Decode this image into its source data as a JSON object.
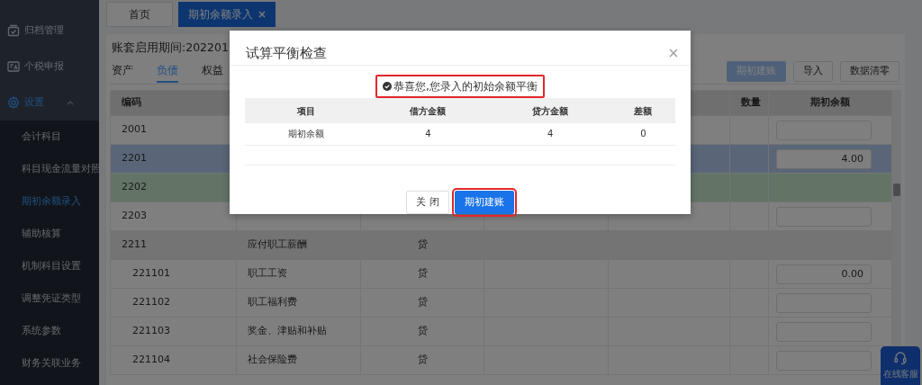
{
  "sidebar": {
    "items": [
      {
        "label": "归档管理",
        "kind": "archive",
        "expanded": false
      },
      {
        "label": "个税申报",
        "kind": "tax",
        "expanded": false
      },
      {
        "label": "设置",
        "kind": "settings",
        "expanded": true,
        "children": [
          {
            "label": "会计科目",
            "selected": false
          },
          {
            "label": "科目现金流量对照",
            "selected": false
          },
          {
            "label": "期初余额录入",
            "selected": true
          },
          {
            "label": "辅助核算",
            "selected": false
          },
          {
            "label": "机制科目设置",
            "selected": false
          },
          {
            "label": "调整凭证类型",
            "selected": false
          },
          {
            "label": "系统参数",
            "selected": false
          },
          {
            "label": "财务关联业务",
            "selected": false
          }
        ]
      }
    ]
  },
  "tabs": [
    {
      "label": "首页",
      "selected": false,
      "closable": false
    },
    {
      "label": "期初余额录入",
      "selected": true,
      "closable": true
    }
  ],
  "period_label": "账套启用期间:202201",
  "category_tabs": [
    {
      "label": "资产",
      "selected": false
    },
    {
      "label": "负债",
      "selected": true
    },
    {
      "label": "权益",
      "selected": false
    }
  ],
  "toolbar_buttons": [
    {
      "label": "期初建账",
      "kind": "primary"
    },
    {
      "label": "导入",
      "kind": "default"
    },
    {
      "label": "数据清零",
      "kind": "default"
    }
  ],
  "table": {
    "columns": {
      "code": "编码",
      "quantity": "数量",
      "opening_balance": "期初余额"
    },
    "rows": [
      {
        "code": "2001",
        "selected": false,
        "hovered": false,
        "editable": true
      },
      {
        "code": "2201",
        "selected": true,
        "hovered": false,
        "editable": true,
        "balance": "4.00"
      },
      {
        "code": "2202",
        "selected": false,
        "hovered": true,
        "editable": false
      },
      {
        "code": "2203",
        "selected": false,
        "hovered": false,
        "editable": true
      },
      {
        "code": "2211",
        "name": "应付职工薪酬",
        "direction": "贷",
        "selected": false,
        "hovered": false,
        "editable": false,
        "children": [
          {
            "code": "221101",
            "name": "职工工资",
            "direction": "贷",
            "selected": false,
            "hovered": false,
            "editable": true,
            "balance": "0.00"
          },
          {
            "code": "221102",
            "name": "职工福利费",
            "direction": "贷",
            "selected": false,
            "hovered": false,
            "editable": true
          },
          {
            "code": "221103",
            "name": "奖金、津贴和补贴",
            "direction": "贷",
            "selected": false,
            "hovered": false,
            "editable": true
          },
          {
            "code": "221104",
            "name": "社会保险费",
            "direction": "贷",
            "selected": false,
            "hovered": false,
            "editable": true
          }
        ]
      }
    ]
  },
  "modal": {
    "title": "试算平衡检查",
    "message": "恭喜您,您录入的初始余额平衡",
    "message_highlighted": true,
    "columns": [
      "项目",
      "借方金额",
      "贷方金额",
      "差额"
    ],
    "rows": [
      [
        "期初余额",
        "4",
        "4",
        "0"
      ]
    ],
    "buttons": [
      {
        "label": "关 闭",
        "kind": "default",
        "highlighted": false
      },
      {
        "label": "期初建账",
        "kind": "primary",
        "highlighted": true
      }
    ]
  },
  "help_widget": {
    "label": "在线客服"
  }
}
